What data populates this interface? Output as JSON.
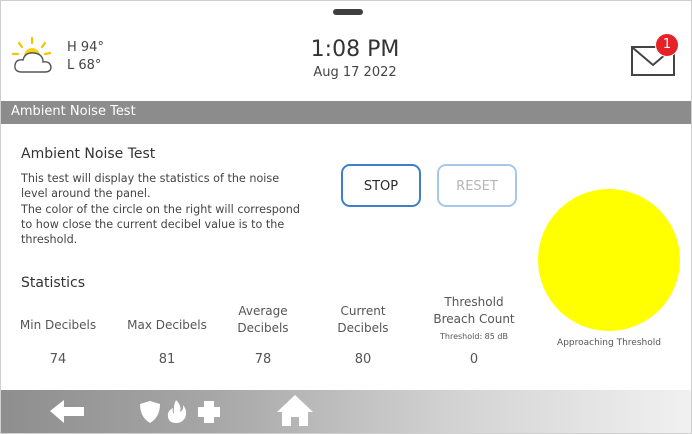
{
  "weather": {
    "icon": "partly-cloudy-icon",
    "high": "H 94°",
    "low": "L 68°"
  },
  "clock": {
    "time": "1:08 PM",
    "date": "Aug 17 2022"
  },
  "notifications": {
    "icon": "mail-icon",
    "count": "1",
    "badge_color": "#e52326"
  },
  "title_bar": {
    "title": "Ambient Noise Test"
  },
  "test": {
    "heading": "Ambient Noise Test",
    "description_lines": [
      "This test will display the statistics of the noise",
      "level around the panel.",
      "The color of the circle on the right will correspond",
      "to how close the current decibel value is to the",
      "threshold."
    ],
    "stop_label": "STOP",
    "reset_label": "RESET"
  },
  "statistics": {
    "heading": "Statistics",
    "columns": [
      {
        "header_lines": [
          "Min Decibels"
        ],
        "value": "74"
      },
      {
        "header_lines": [
          "Max Decibels"
        ],
        "value": "81"
      },
      {
        "header_lines": [
          "Average",
          "Decibels"
        ],
        "value": "78"
      },
      {
        "header_lines": [
          "Current",
          "Decibels"
        ],
        "value": "80"
      },
      {
        "header_lines": [
          "Threshold",
          "Breach Count"
        ],
        "value": "0"
      }
    ],
    "threshold_note": "Threshold: 85 dB"
  },
  "indicator": {
    "color": "#ffff00",
    "label": "Approaching Threshold"
  },
  "nav": {
    "items": [
      "back-arrow-icon",
      "shield-icon",
      "fire-icon",
      "medical-cross-icon",
      "home-icon"
    ]
  }
}
